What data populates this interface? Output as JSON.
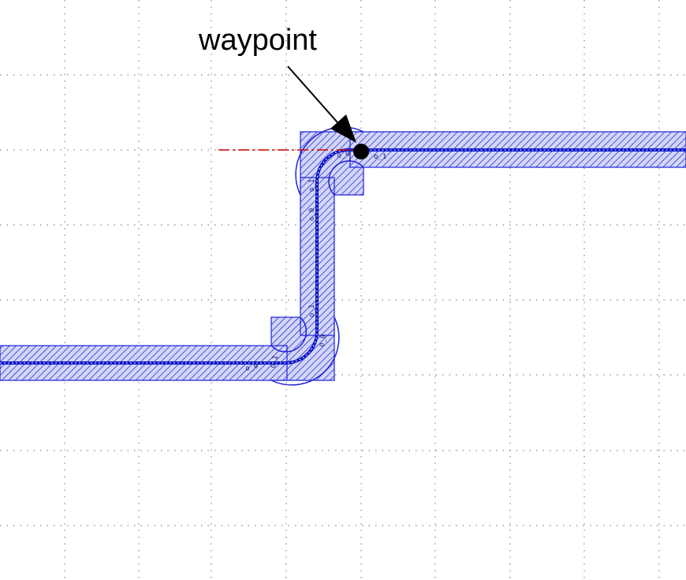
{
  "annotation": {
    "label": "waypoint"
  },
  "colors": {
    "background": "#ffffff",
    "grid": "#9a9a9a",
    "waveguide_fill": "#c9cdf7",
    "waveguide_hatch": "#2a33d6",
    "waveguide_outline": "#1c22d8",
    "core": "#0a12c8",
    "guide_line": "#d10000",
    "annotation": "#000000"
  },
  "segment_labels": [
    "o_0",
    "o_1",
    "o_0",
    "o_1",
    "o_0",
    "o_1",
    "o_0",
    "o_1"
  ]
}
